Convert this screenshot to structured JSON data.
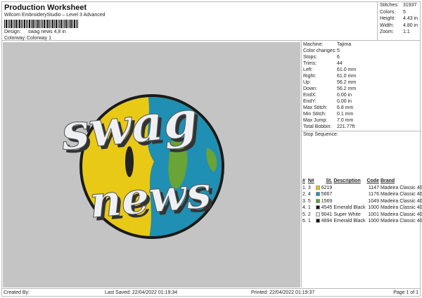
{
  "header": {
    "title": "Production Worksheet",
    "subtitle": "Wilcom EmbroideryStudio – Level 3 Advanced",
    "design_label": "Design:",
    "design_value": "swag news 4,8 in",
    "colorway_label": "Colorway:",
    "colorway_value": "Colorway 1"
  },
  "stats": [
    {
      "label": "Stitches:",
      "value": "31937"
    },
    {
      "label": "Colors:",
      "value": "5"
    },
    {
      "label": "Height:",
      "value": "4.43 in"
    },
    {
      "label": "Width:",
      "value": "4.80 in"
    },
    {
      "label": "Zoom:",
      "value": "1:1"
    }
  ],
  "details": [
    {
      "label": "Machine:",
      "value": "Tajima"
    },
    {
      "label": "Color changes:",
      "value": "5"
    },
    {
      "label": "Stops:",
      "value": "6"
    },
    {
      "label": "Trims:",
      "value": "44"
    },
    {
      "label": "Left:",
      "value": "61.0 mm"
    },
    {
      "label": "Right:",
      "value": "61.0 mm"
    },
    {
      "label": "Up:",
      "value": "56.2 mm"
    },
    {
      "label": "Down:",
      "value": "56.2 mm"
    },
    {
      "label": "EndX:",
      "value": "0.00 in"
    },
    {
      "label": "EndY:",
      "value": "0.00 in"
    },
    {
      "label": "Max Stitch:",
      "value": "6.8 mm"
    },
    {
      "label": "Min Stitch:",
      "value": "0.1 mm"
    },
    {
      "label": "Max Jump:",
      "value": "7.0 mm"
    },
    {
      "label": "Total Bobbin:",
      "value": "221.77ft"
    }
  ],
  "stop_sequence": {
    "title": "Stop Sequence:",
    "columns": [
      "#",
      "N#",
      "St.",
      "Description",
      "Code",
      "Brand"
    ],
    "rows": [
      {
        "n": "1.",
        "nn": "3",
        "color": "#f2c500",
        "st": "6219",
        "desc": "",
        "code": "1147",
        "brand": "Madeira Classic 40"
      },
      {
        "n": "2.",
        "nn": "4",
        "color": "#1a8fc0",
        "st": "5667",
        "desc": "",
        "code": "1176",
        "brand": "Madeira Classic 40"
      },
      {
        "n": "3.",
        "nn": "5",
        "color": "#5aa02c",
        "st": "1569",
        "desc": "",
        "code": "1049",
        "brand": "Madeira Classic 40"
      },
      {
        "n": "4.",
        "nn": "1",
        "color": "#111111",
        "st": "4545",
        "desc": "Emerald Black",
        "code": "1000",
        "brand": "Madeira Classic 40"
      },
      {
        "n": "5.",
        "nn": "2",
        "color": "#e6e8f0",
        "st": "9041",
        "desc": "Super White",
        "code": "1001",
        "brand": "Madeira Classic 40"
      },
      {
        "n": "6.",
        "nn": "1",
        "color": "#111111",
        "st": "4894",
        "desc": "Emerald Black",
        "code": "1000",
        "brand": "Madeira Classic 40"
      }
    ]
  },
  "design_art": {
    "text_top": "swag",
    "text_bottom": "news"
  },
  "footer": {
    "created": "Created By:",
    "saved": "Last Saved: 22/04/2022 01:19:34",
    "printed": "Printed: 22/04/2022 01:19:37",
    "page": "Page 1 of 1"
  }
}
